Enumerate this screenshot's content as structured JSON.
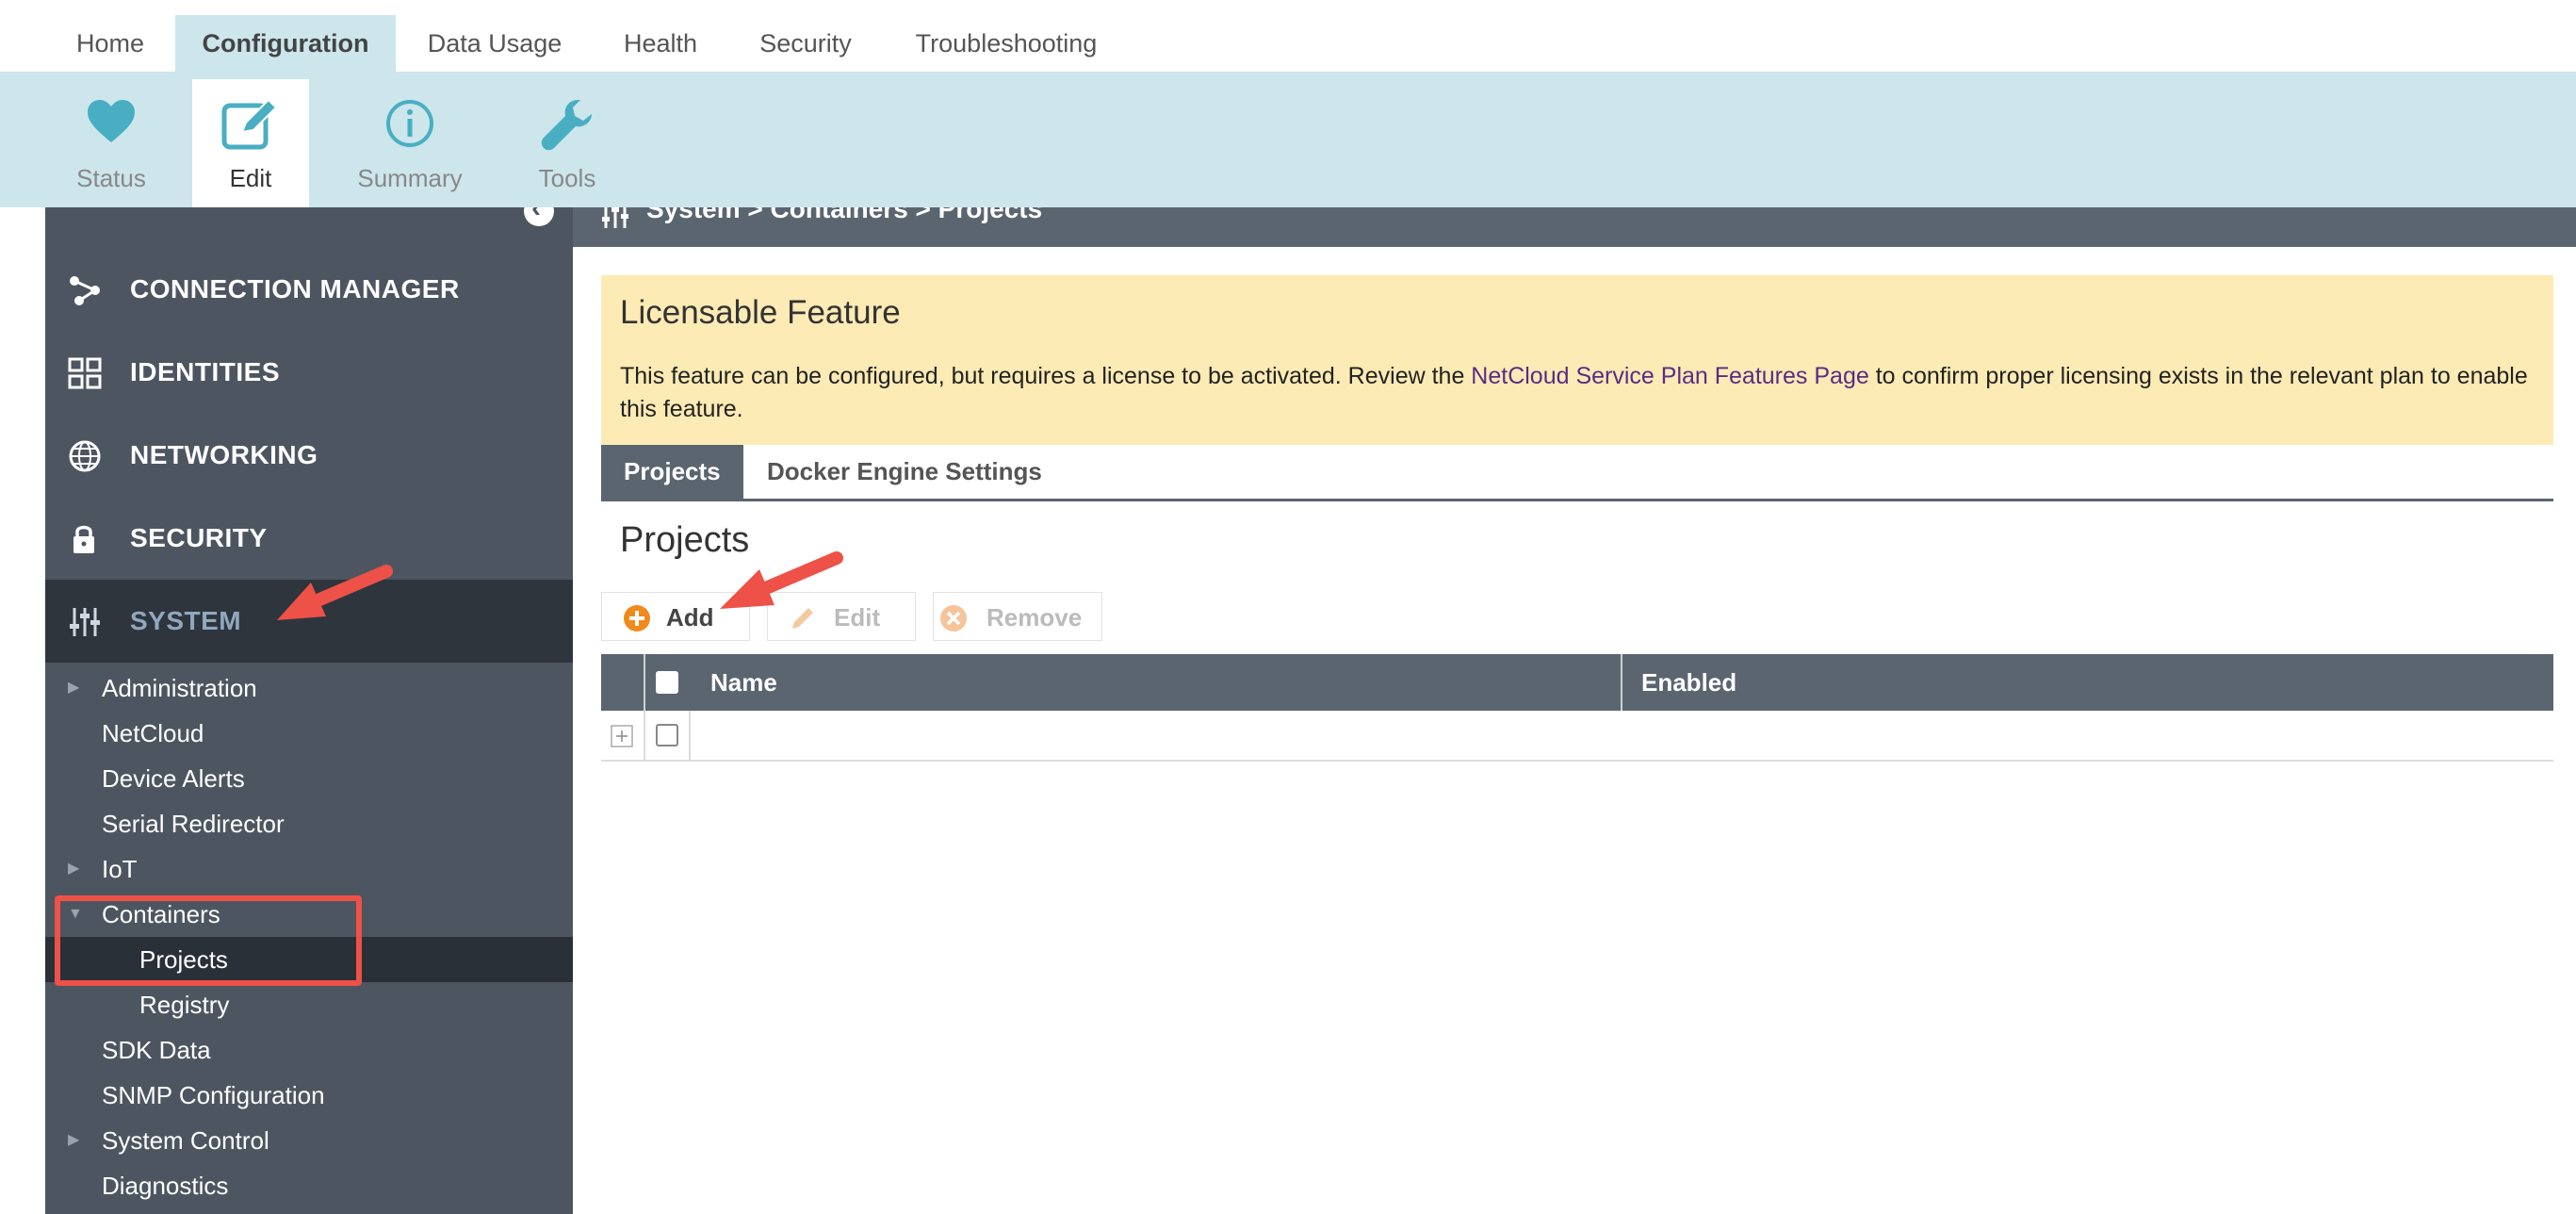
{
  "topnav": {
    "tabs": [
      {
        "label": "Home"
      },
      {
        "label": "Configuration"
      },
      {
        "label": "Data Usage"
      },
      {
        "label": "Health"
      },
      {
        "label": "Security"
      },
      {
        "label": "Troubleshooting"
      }
    ],
    "active": "Configuration"
  },
  "subbar": {
    "tools": [
      {
        "label": "Status",
        "icon": "heart-icon"
      },
      {
        "label": "Edit",
        "icon": "edit-icon"
      },
      {
        "label": "Summary",
        "icon": "info-icon"
      },
      {
        "label": "Tools",
        "icon": "wrench-icon"
      }
    ],
    "active": "Edit"
  },
  "sidebar": {
    "sections": [
      {
        "label": "CONNECTION MANAGER",
        "icon": "connection-icon"
      },
      {
        "label": "IDENTITIES",
        "icon": "grid-icon"
      },
      {
        "label": "NETWORKING",
        "icon": "globe-icon"
      },
      {
        "label": "SECURITY",
        "icon": "lock-icon"
      },
      {
        "label": "SYSTEM",
        "icon": "sliders-icon"
      }
    ],
    "active_section": "SYSTEM",
    "items": [
      {
        "label": "Administration"
      },
      {
        "label": "NetCloud"
      },
      {
        "label": "Device Alerts"
      },
      {
        "label": "Serial Redirector"
      },
      {
        "label": "IoT"
      },
      {
        "label": "Containers"
      },
      {
        "label": "Projects"
      },
      {
        "label": "Registry"
      },
      {
        "label": "SDK Data"
      },
      {
        "label": "SNMP Configuration"
      },
      {
        "label": "System Control"
      },
      {
        "label": "Diagnostics"
      }
    ],
    "selected_item": "Projects"
  },
  "breadcrumb": "System > Containers > Projects",
  "notice": {
    "title": "Licensable Feature",
    "body_before": "This feature can be configured, but requires a license to be activated. Review the ",
    "link": "NetCloud Service Plan Features Page",
    "body_after": " to confirm proper licensing exists in the relevant plan to enable this feature."
  },
  "subtabs": [
    {
      "label": "Projects"
    },
    {
      "label": "Docker Engine Settings"
    }
  ],
  "active_subtab": "Projects",
  "page_title": "Projects",
  "toolbar": {
    "add_label": "Add",
    "edit_label": "Edit",
    "remove_label": "Remove"
  },
  "table": {
    "columns": [
      "Name",
      "Enabled"
    ],
    "rows": []
  },
  "colors": {
    "accent": "#4aaec2",
    "sidebar": "#4d5660",
    "notice_bg": "#fcebb4",
    "annotation": "#ee5147"
  }
}
